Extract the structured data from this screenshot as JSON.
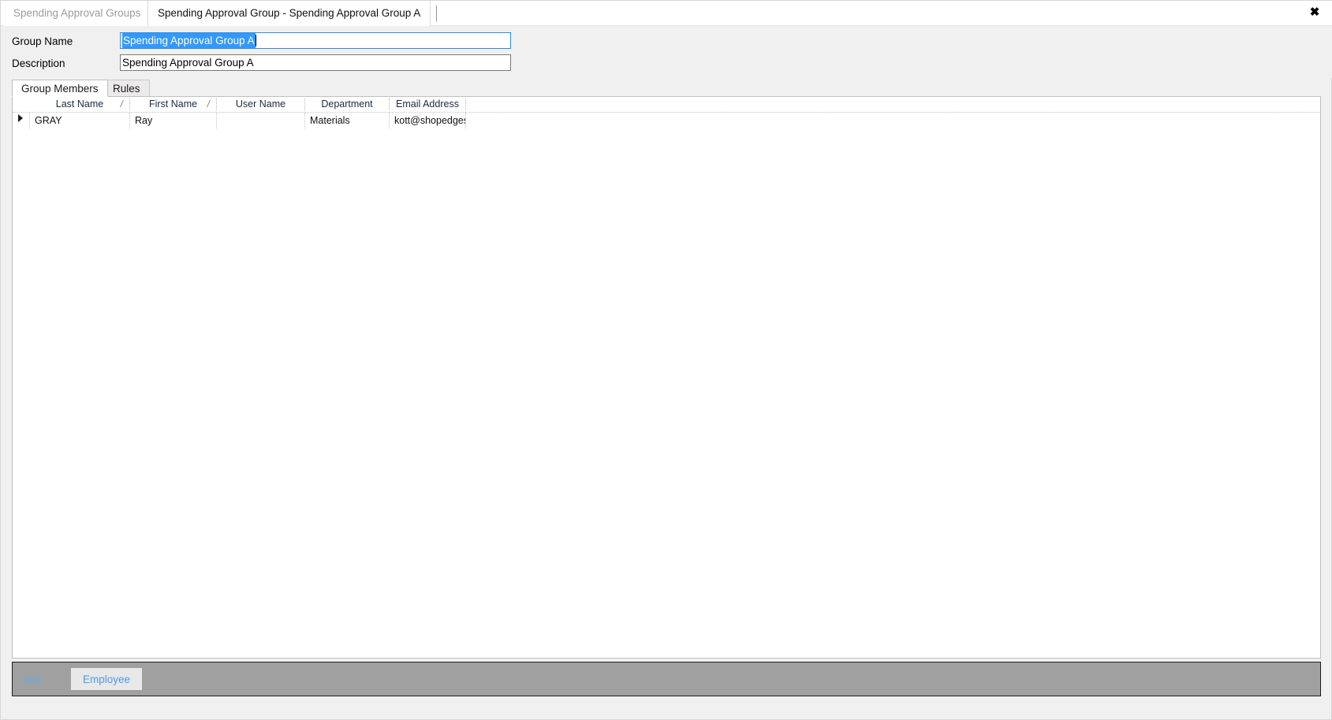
{
  "window": {
    "close_icon": "close-icon",
    "close_glyph": "✖"
  },
  "top_tabs": [
    {
      "label": "Spending Approval Groups",
      "active": false
    },
    {
      "label": "Spending Approval Group - Spending Approval Group A",
      "active": true
    }
  ],
  "form": {
    "group_name_label": "Group Name",
    "group_name_value": "Spending Approval Group A",
    "description_label": "Description",
    "description_value": "Spending Approval Group A"
  },
  "sub_tabs": [
    {
      "label": "Group Members",
      "active": true
    },
    {
      "label": "Rules",
      "active": false
    }
  ],
  "grid": {
    "columns": [
      {
        "label": "Last Name",
        "sort": "/"
      },
      {
        "label": "First Name",
        "sort": "/"
      },
      {
        "label": "User Name",
        "sort": ""
      },
      {
        "label": "Department",
        "sort": ""
      },
      {
        "label": "Email Address",
        "sort": ""
      }
    ],
    "rows": [
      {
        "last_name": "GRAY",
        "first_name": "Ray",
        "user_name": "",
        "department": "Materials",
        "email_address": "kott@shopedgeso"
      }
    ]
  },
  "action_bar": {
    "add_label": "Add ...",
    "employee_button": "Employee"
  },
  "colors": {
    "selection_blue": "#3399ff",
    "focus_border": "#2e8ae6",
    "action_bar_gray": "#a0a0a0",
    "link_blue": "#4a9bf0",
    "muted_link_blue": "#6aa9e8",
    "inactive_tab_text": "#9b9b9b"
  }
}
